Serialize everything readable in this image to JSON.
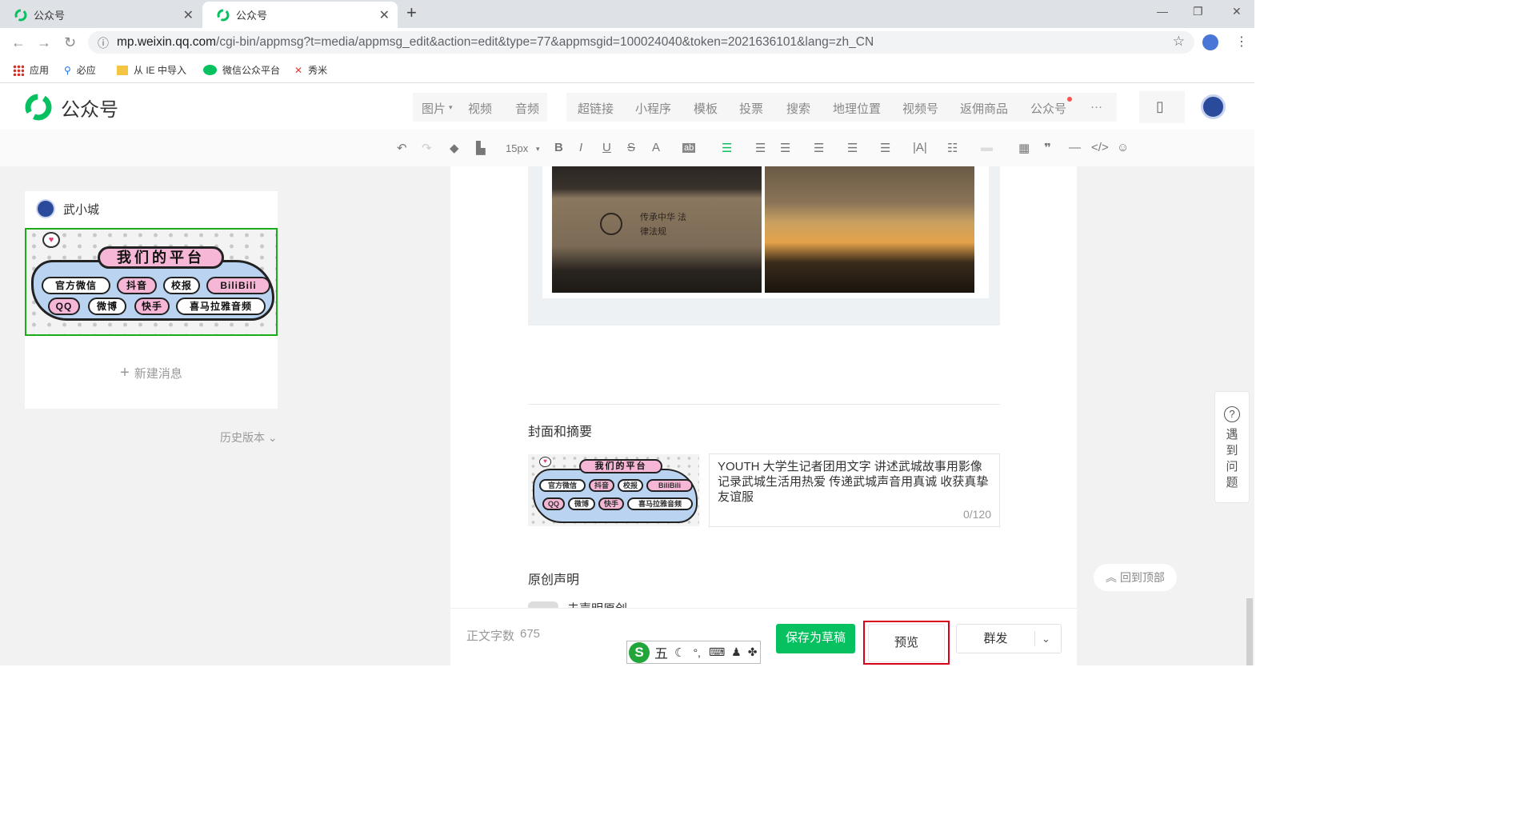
{
  "browser": {
    "tabs": [
      {
        "title": "公众号",
        "active": false
      },
      {
        "title": "公众号",
        "active": true
      }
    ],
    "url_domain": "mp.weixin.qq.com",
    "url_path": "/cgi-bin/appmsg?t=media/appmsg_edit&action=edit&type=77&appmsgid=100024040&token=2021636101&lang=zh_CN",
    "bookmarks": [
      "应用",
      "必应",
      "从 IE 中导入",
      "微信公众平台",
      "秀米"
    ]
  },
  "header": {
    "brand": "公众号",
    "insert_group1": [
      "图片",
      "视频",
      "音频"
    ],
    "insert_group2": [
      "超链接",
      "小程序",
      "模板",
      "投票",
      "搜索",
      "地理位置",
      "视频号",
      "返佣商品",
      "公众号",
      "···"
    ]
  },
  "toolbar": {
    "font_size": "15px"
  },
  "sidebar": {
    "account": "武小城",
    "poster_title": "我们的平台",
    "poster_row1": [
      "官方微信",
      "抖音",
      "校报",
      "BiliBili"
    ],
    "poster_row2": [
      "QQ",
      "微博",
      "快手",
      "喜马拉雅音频"
    ],
    "new_message": "新建消息",
    "history": "历史版本"
  },
  "editor": {
    "cover_heading": "封面和摘要",
    "summary": "YOUTH 大学生记者团用文字 讲述武城故事用影像 记录武城生活用热爱 传递武城声音用真诚 收获真挚友谊服",
    "summary_count": "0/120",
    "original_heading": "原创声明",
    "original_toggle": "未声明原创",
    "photo_text": "传承中华 法律法规"
  },
  "footer": {
    "word_count_label": "正文字数",
    "word_count": "675",
    "save_draft": "保存为草稿",
    "preview": "预览",
    "publish": "群发"
  },
  "side": {
    "help": "遇到问题",
    "back_to_top": "回到顶部"
  },
  "ime": {
    "mode": "五"
  },
  "colors": {
    "brand_green": "#07c160",
    "save_green": "#07c160",
    "preview_border": "#d9001b"
  }
}
